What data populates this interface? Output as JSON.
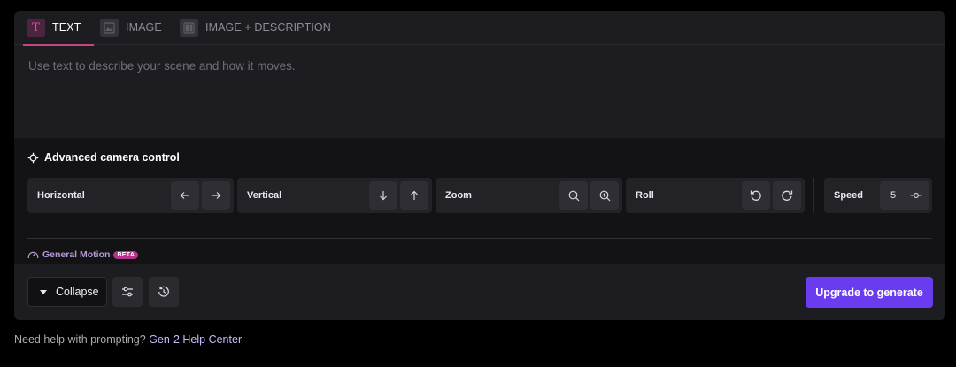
{
  "tabs": [
    {
      "label": "TEXT",
      "icon": "text-icon",
      "active": true
    },
    {
      "label": "IMAGE",
      "icon": "image-icon",
      "active": false
    },
    {
      "label": "IMAGE + DESCRIPTION",
      "icon": "image-description-icon",
      "active": false
    }
  ],
  "prompt": {
    "placeholder": "Use text to describe your scene and how it moves.",
    "value": ""
  },
  "camera": {
    "title": "Advanced camera control",
    "controls": [
      {
        "label": "Horizontal",
        "buttons": [
          "arrow-left-icon",
          "arrow-right-icon"
        ]
      },
      {
        "label": "Vertical",
        "buttons": [
          "arrow-down-icon",
          "arrow-up-icon"
        ]
      },
      {
        "label": "Zoom",
        "buttons": [
          "zoom-out-icon",
          "zoom-in-icon"
        ]
      },
      {
        "label": "Roll",
        "buttons": [
          "rotate-ccw-icon",
          "rotate-cw-icon"
        ]
      }
    ],
    "speed": {
      "label": "Speed",
      "value": "5"
    },
    "general_motion": {
      "label": "General Motion",
      "badge": "BETA"
    }
  },
  "footer": {
    "collapse_label": "Collapse",
    "settings_icon": "sliders-icon",
    "history_icon": "history-icon",
    "upgrade_label": "Upgrade to generate"
  },
  "help": {
    "text": "Need help with prompting?",
    "link": "Gen-2 Help Center"
  },
  "colors": {
    "accent": "#6a3cef",
    "tab_highlight": "#c5457f",
    "beta": "#b3348a",
    "link": "#c9b8ff"
  }
}
